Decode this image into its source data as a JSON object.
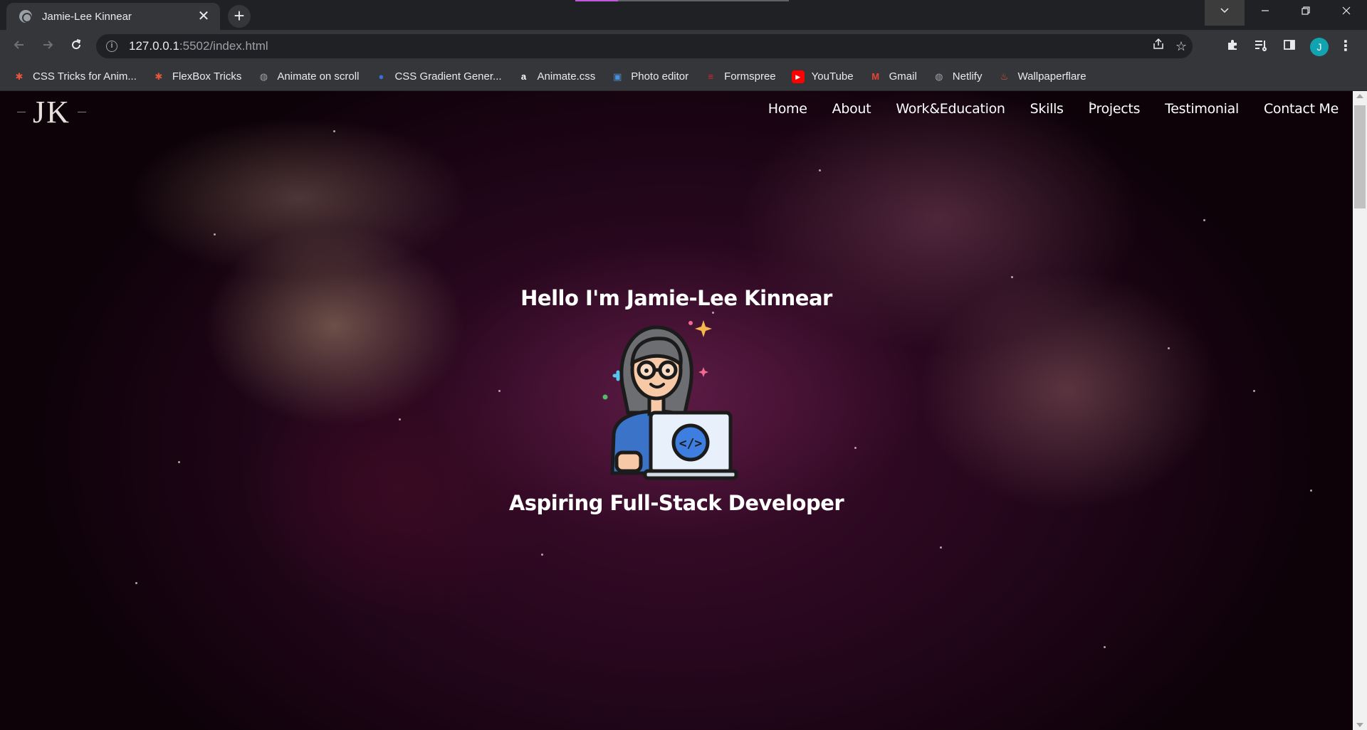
{
  "browser": {
    "tab_title": "Jamie-Lee Kinnear",
    "tab_close": "✕",
    "new_tab": "+",
    "url_host": "127.0.0.1",
    "url_rest": ":5502/index.html",
    "profile_initial": "J"
  },
  "bookmarks": [
    {
      "label": "CSS Tricks for Anim...",
      "icon": "asterisk-icon",
      "color": "#e8553e"
    },
    {
      "label": "FlexBox Tricks",
      "icon": "asterisk-icon",
      "color": "#e8553e"
    },
    {
      "label": "Animate on scroll",
      "icon": "globe-icon",
      "color": "#9aa0a6"
    },
    {
      "label": "CSS Gradient Gener...",
      "icon": "gradient-icon",
      "color": "#3a6fd8"
    },
    {
      "label": "Animate.css",
      "icon": "animate-icon",
      "color": "#ffffff"
    },
    {
      "label": "Photo editor",
      "icon": "photo-icon",
      "color": "#4a90d9"
    },
    {
      "label": "Formspree",
      "icon": "formspree-icon",
      "color": "#e5202e"
    },
    {
      "label": "YouTube",
      "icon": "youtube-icon",
      "color": "#ff0000"
    },
    {
      "label": "Gmail",
      "icon": "gmail-icon",
      "color": "#ea4335"
    },
    {
      "label": "Netlify",
      "icon": "globe-icon",
      "color": "#9aa0a6"
    },
    {
      "label": "Wallpaperflare",
      "icon": "flame-icon",
      "color": "#e0553b"
    }
  ],
  "site": {
    "logo": "JK",
    "nav": [
      "Home",
      "About",
      "Work&Education",
      "Skills",
      "Projects",
      "Testimonial",
      "Contact Me"
    ],
    "hero_title": "Hello I'm Jamie-Lee Kinnear",
    "hero_subtitle": "Aspiring Full-Stack Developer",
    "code_glyph": "</>"
  }
}
